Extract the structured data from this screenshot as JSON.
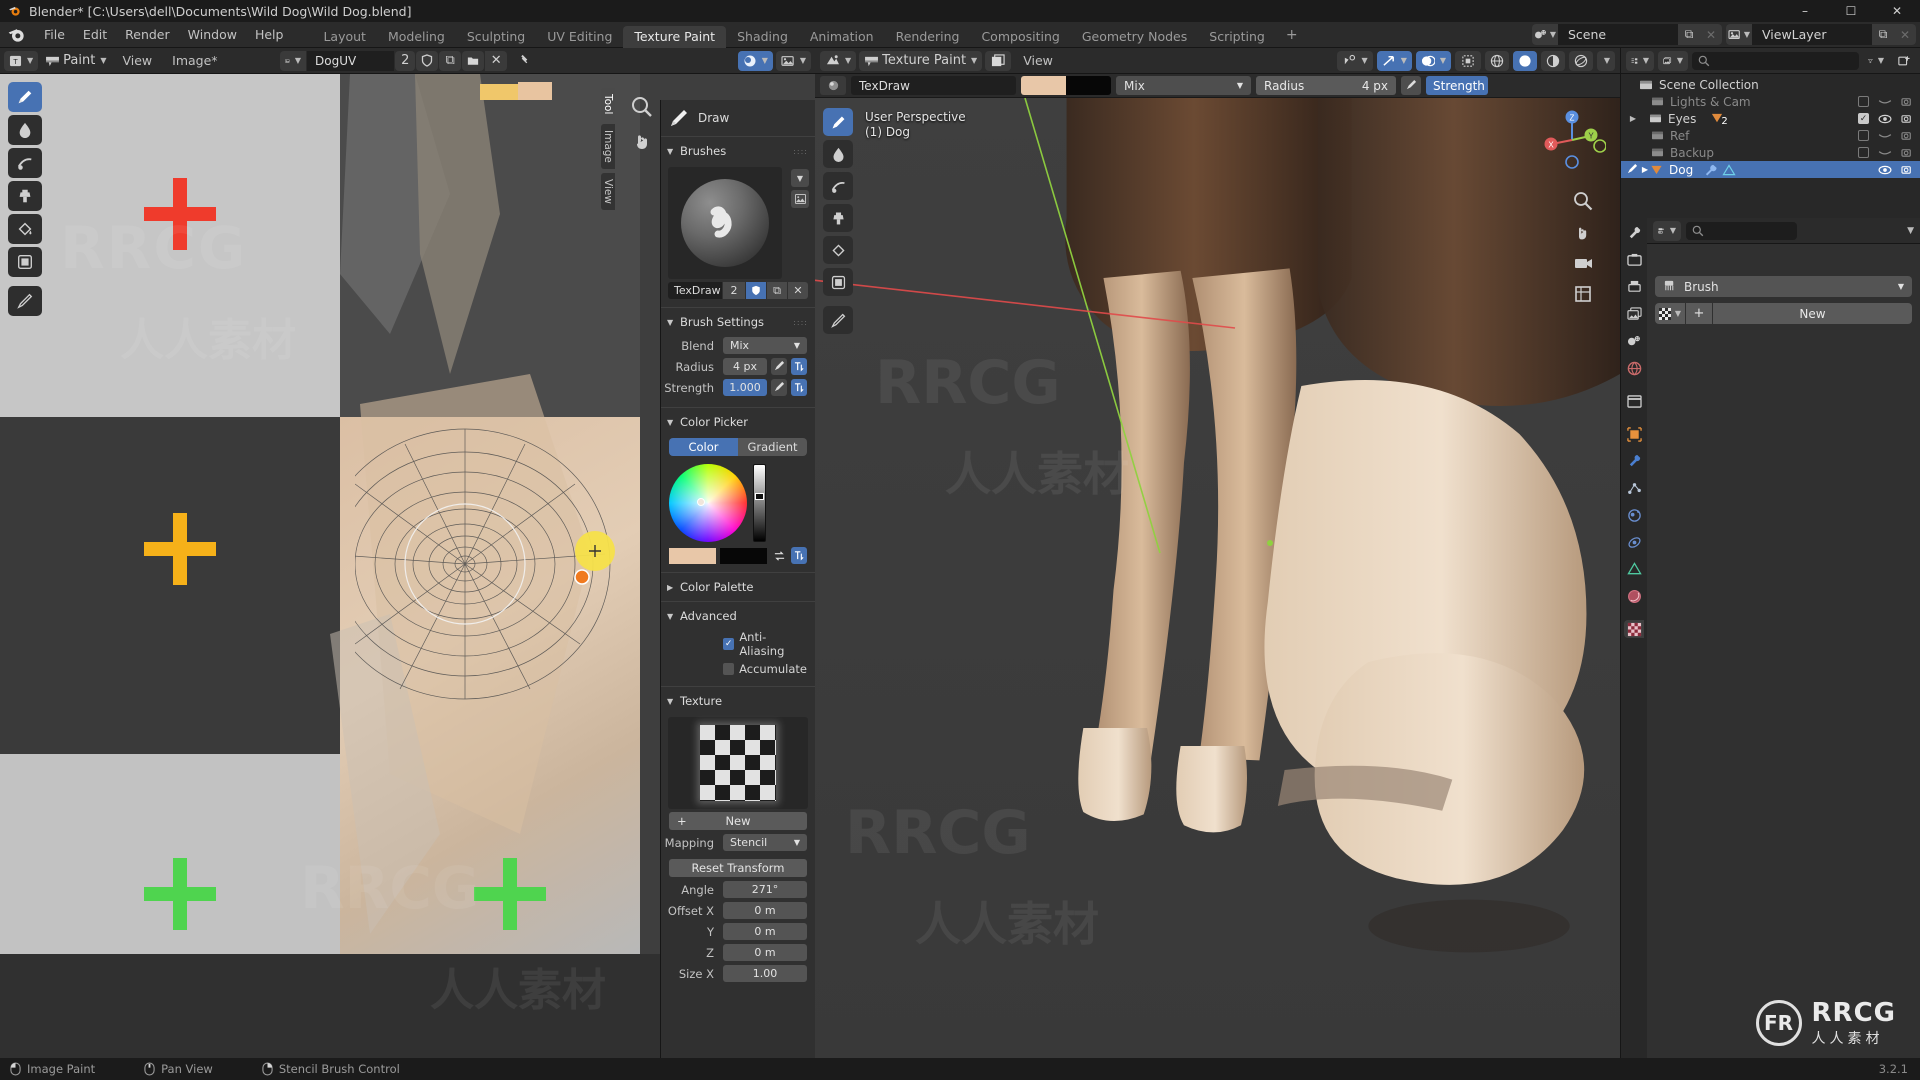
{
  "window": {
    "title": "Blender* [C:\\Users\\dell\\Documents\\Wild Dog\\Wild Dog.blend]",
    "minimize": "–",
    "maximize": "☐",
    "close": "✕"
  },
  "topbar": {
    "menus": [
      "File",
      "Edit",
      "Render",
      "Window",
      "Help"
    ],
    "workspaces": [
      {
        "label": "Layout",
        "active": false
      },
      {
        "label": "Modeling",
        "active": false
      },
      {
        "label": "Sculpting",
        "active": false
      },
      {
        "label": "UV Editing",
        "active": false
      },
      {
        "label": "Texture Paint",
        "active": true
      },
      {
        "label": "Shading",
        "active": false
      },
      {
        "label": "Animation",
        "active": false
      },
      {
        "label": "Rendering",
        "active": false
      },
      {
        "label": "Compositing",
        "active": false
      },
      {
        "label": "Geometry Nodes",
        "active": false
      },
      {
        "label": "Scripting",
        "active": false
      }
    ],
    "add_workspace": "+",
    "scene_name": "Scene",
    "viewlayer_name": "ViewLayer",
    "new_copy": "⧉",
    "unlink": "✕"
  },
  "image_editor": {
    "mode": "Paint",
    "menus": [
      "View",
      "Image*"
    ],
    "image_name": "DogUV",
    "image_users": "2",
    "buttons": {
      "fake_user": "shield-icon",
      "new_copy": "⧉",
      "open": "folder-icon",
      "unlink": "✕",
      "pin": "pin-icon"
    },
    "tool_column": [
      {
        "name": "draw-tool",
        "active": true
      },
      {
        "name": "soften-tool",
        "active": false
      },
      {
        "name": "smear-tool",
        "active": false
      },
      {
        "name": "clone-tool",
        "active": false
      },
      {
        "name": "fill-tool",
        "active": false
      },
      {
        "name": "mask-tool",
        "active": false
      },
      {
        "name": "annotate-tool",
        "active": false
      }
    ],
    "side_tabs": [
      {
        "label": "Tool",
        "active": true
      },
      {
        "label": "Image",
        "active": false
      },
      {
        "label": "View",
        "active": false
      }
    ]
  },
  "npanel": {
    "active_tool": "Draw",
    "sections": {
      "brushes": {
        "title": "Brushes",
        "expanded": true
      },
      "brush_settings": {
        "title": "Brush Settings",
        "expanded": true
      },
      "color_picker": {
        "title": "Color Picker",
        "expanded": true
      },
      "color_palette": {
        "title": "Color Palette",
        "expanded": false
      },
      "advanced": {
        "title": "Advanced",
        "expanded": true
      },
      "texture": {
        "title": "Texture",
        "expanded": true
      }
    },
    "brush": {
      "name": "TexDraw",
      "users": "2",
      "fake_user_on": true,
      "new_copy": "⧉",
      "unlink": "✕"
    },
    "brush_settings": {
      "blend_label": "Blend",
      "blend_value": "Mix",
      "radius_label": "Radius",
      "radius_value": "4 px",
      "strength_label": "Strength",
      "strength_value": "1.000"
    },
    "color_picker": {
      "tab_color": "Color",
      "tab_gradient": "Gradient",
      "active_tab": "Color",
      "primary_color": "#e8c7a8",
      "secondary_color": "#070707",
      "swap_icon": "swap-colors-icon"
    },
    "advanced": {
      "anti_aliasing_label": "Anti-Aliasing",
      "anti_aliasing_checked": true,
      "accumulate_label": "Accumulate",
      "accumulate_checked": false
    },
    "texture": {
      "new_button": "New",
      "plus": "+",
      "mapping_label": "Mapping",
      "mapping_value": "Stencil",
      "reset_transform": "Reset Transform",
      "angle_label": "Angle",
      "angle_value": "271°",
      "offset_x_label": "Offset X",
      "offset_x_value": "0 m",
      "offset_y_label": "Y",
      "offset_y_value": "0 m",
      "offset_z_label": "Z",
      "offset_z_value": "0 m",
      "size_x_label": "Size X",
      "size_x_value": "1.00"
    }
  },
  "viewport": {
    "mode": "Texture Paint",
    "menus": [
      "View"
    ],
    "overlay_line1": "User Perspective",
    "overlay_line2": "(1) Dog",
    "tool_header": {
      "brush_name": "TexDraw",
      "primary_color": "#e8c7a8",
      "secondary_color": "#070707",
      "blend_value": "Mix",
      "radius_label": "Radius",
      "radius_value": "4 px",
      "strength_label": "Strength"
    },
    "gizmo_axes": [
      {
        "label": "X",
        "color": "#e05a5a"
      },
      {
        "label": "Y",
        "color": "#9ed04a"
      },
      {
        "label": "Z",
        "color": "#5a8fe0"
      }
    ],
    "nav_icons": [
      "zoom-icon",
      "pan-icon",
      "camera-icon",
      "ortho-toggle-icon"
    ],
    "shading_modes": [
      "wireframe",
      "solid",
      "material-preview",
      "rendered"
    ],
    "active_shading": "solid",
    "tool_column": [
      {
        "name": "draw-tool",
        "active": true
      },
      {
        "name": "soften-tool",
        "active": false
      },
      {
        "name": "smear-tool",
        "active": false
      },
      {
        "name": "clone-tool",
        "active": false
      },
      {
        "name": "fill-tool",
        "active": false
      },
      {
        "name": "mask-tool",
        "active": false
      },
      {
        "name": "annotate-tool",
        "active": false
      }
    ]
  },
  "outliner": {
    "display_mode": "View Layer",
    "search_placeholder": "",
    "filter_icon": "filter-icon",
    "new_collection_icon": "new-collection-icon",
    "rows": [
      {
        "label": "Scene Collection",
        "indent": 0,
        "type": "collection",
        "selected": false,
        "dim": false,
        "checkbox": null,
        "eye": null,
        "camera": false
      },
      {
        "label": "Lights & Cam",
        "indent": 1,
        "type": "collection",
        "selected": false,
        "dim": true,
        "checkbox": false,
        "eye": "closed",
        "camera": true
      },
      {
        "label": "Eyes",
        "indent": 1,
        "type": "collection",
        "selected": false,
        "dim": false,
        "checkbox": true,
        "eye": "open",
        "camera": true,
        "badge": "2"
      },
      {
        "label": "Ref",
        "indent": 1,
        "type": "collection",
        "selected": false,
        "dim": true,
        "checkbox": false,
        "eye": "closed",
        "camera": true
      },
      {
        "label": "Backup",
        "indent": 1,
        "type": "collection",
        "selected": false,
        "dim": true,
        "checkbox": false,
        "eye": "closed",
        "camera": true
      },
      {
        "label": "Dog",
        "indent": 1,
        "type": "object",
        "selected": true,
        "dim": false,
        "checkbox": null,
        "eye": "open",
        "camera": true
      }
    ]
  },
  "properties": {
    "search_placeholder": "",
    "pin_icon": "pin-icon",
    "tabs": [
      {
        "name": "tool",
        "active": false
      },
      {
        "name": "render",
        "active": false
      },
      {
        "name": "output",
        "active": false
      },
      {
        "name": "view-layer",
        "active": false
      },
      {
        "name": "scene",
        "active": false
      },
      {
        "name": "world",
        "active": false
      },
      {
        "name": "collection",
        "active": false
      },
      {
        "name": "object",
        "active": false
      },
      {
        "name": "modifiers",
        "active": false
      },
      {
        "name": "particles",
        "active": false
      },
      {
        "name": "physics",
        "active": false
      },
      {
        "name": "constraints",
        "active": false
      },
      {
        "name": "object-data",
        "active": false
      },
      {
        "name": "material",
        "active": false
      },
      {
        "name": "texture",
        "active": true
      }
    ],
    "brush_label": "Brush",
    "new_button": "New",
    "plus": "+"
  },
  "statusbar": {
    "items": [
      {
        "icon": "mouse-left",
        "label": "Image Paint"
      },
      {
        "icon": "mouse-middle",
        "label": "Pan View"
      },
      {
        "icon": "mouse-right",
        "label": "Stencil Brush Control"
      }
    ],
    "version": "3.2.1"
  },
  "watermarks": {
    "brand": "RRCG",
    "brand_sub": "人人素材",
    "logo_text": "FR"
  }
}
